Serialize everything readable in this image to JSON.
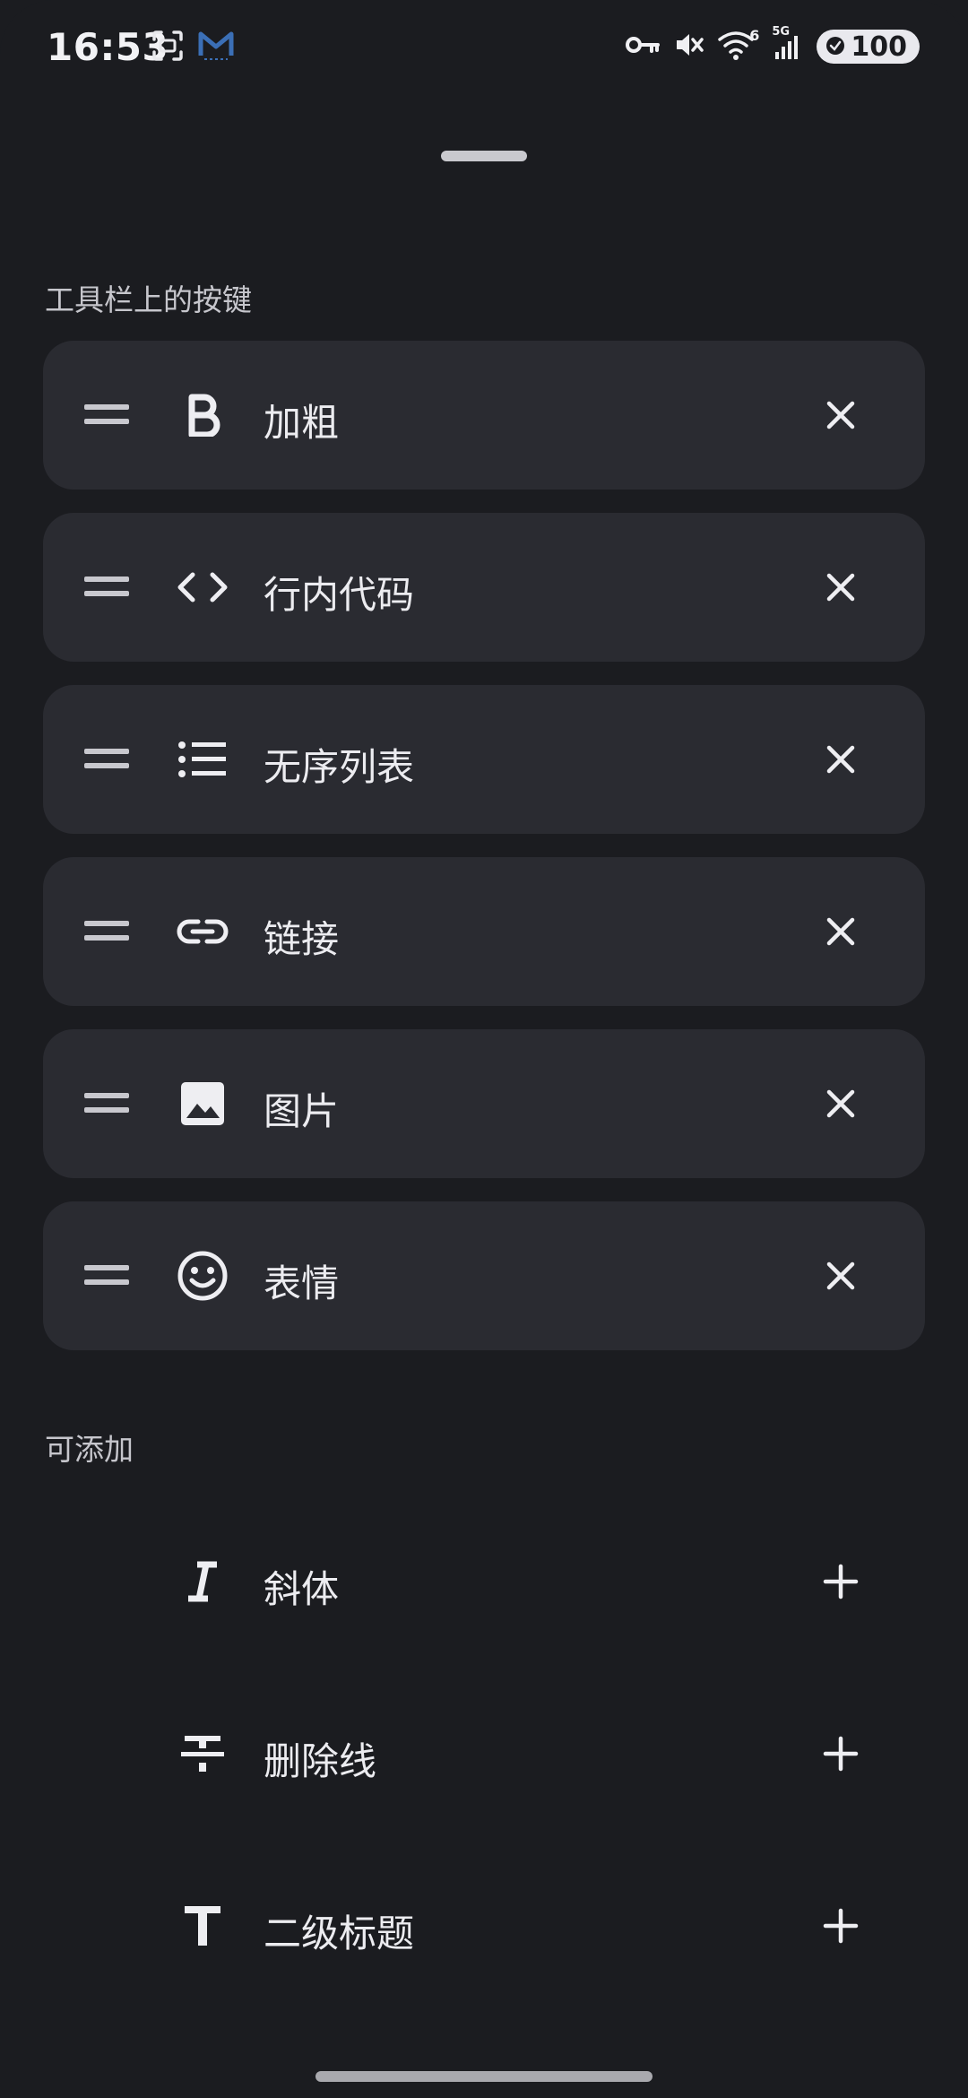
{
  "status_bar": {
    "time": "16:53",
    "battery": "100",
    "network_label": "5G",
    "wifi_label": "6"
  },
  "sections": {
    "toolbar_title": "工具栏上的按键",
    "available_title": "可添加"
  },
  "toolbar_items": [
    {
      "label": "加粗",
      "icon": "bold-icon"
    },
    {
      "label": "行内代码",
      "icon": "code-icon"
    },
    {
      "label": "无序列表",
      "icon": "bullet-list-icon"
    },
    {
      "label": "链接",
      "icon": "link-icon"
    },
    {
      "label": "图片",
      "icon": "image-icon"
    },
    {
      "label": "表情",
      "icon": "emoji-icon"
    }
  ],
  "available_items": [
    {
      "label": "斜体",
      "icon": "italic-icon"
    },
    {
      "label": "删除线",
      "icon": "strikethrough-icon"
    },
    {
      "label": "二级标题",
      "icon": "heading-icon"
    }
  ]
}
